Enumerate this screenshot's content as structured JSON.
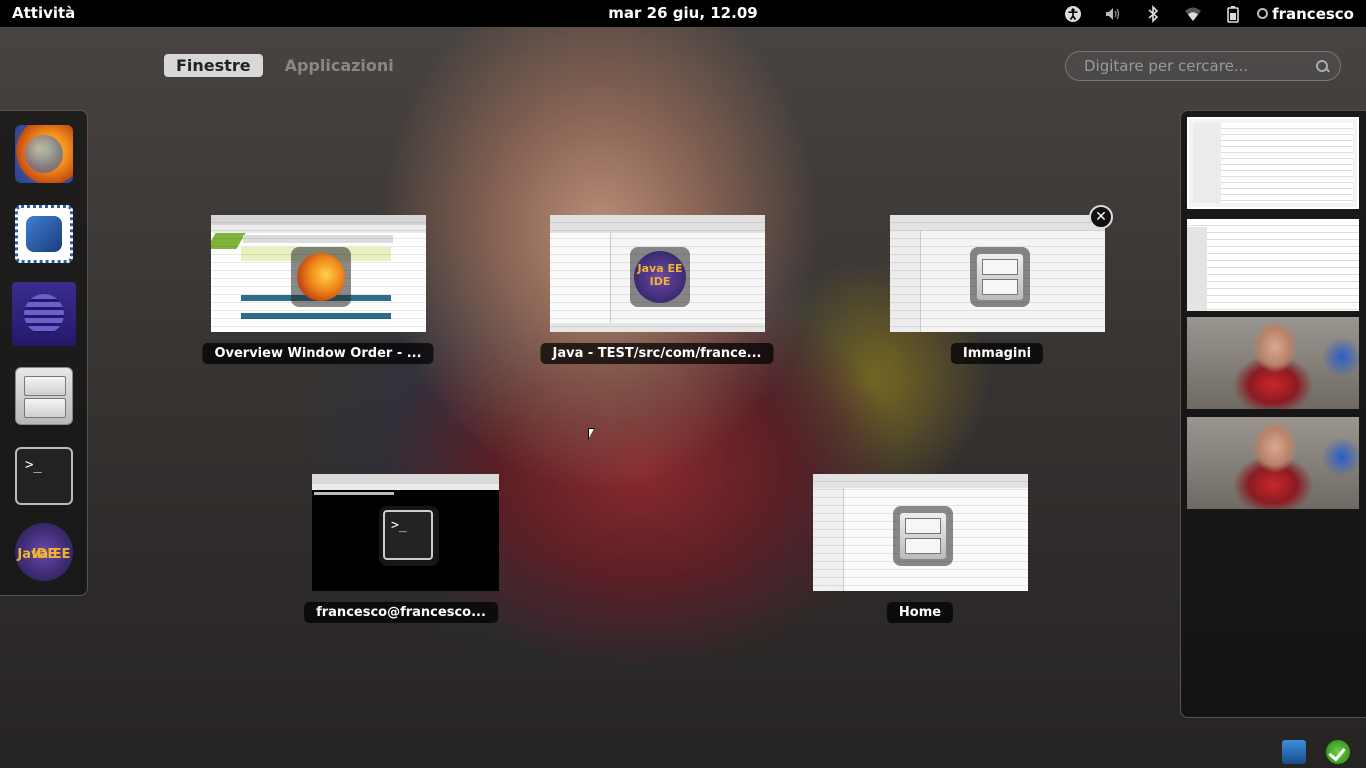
{
  "topbar": {
    "activities_label": "Attività",
    "clock": "mar 26 giu, 12.09",
    "user": "francesco",
    "tray_icons": [
      "accessibility-icon",
      "volume-icon",
      "bluetooth-icon",
      "wifi-icon",
      "battery-icon"
    ]
  },
  "tabs": {
    "windows": "Finestre",
    "applications": "Applicazioni"
  },
  "search": {
    "placeholder": "Digitare per cercare..."
  },
  "dash": {
    "apps": [
      "firefox",
      "mail",
      "eclipse",
      "files",
      "terminal",
      "java-ee-ide"
    ],
    "terminal_glyph": ">_",
    "javaee_text_1": "Java EE",
    "javaee_text_2": "IDE"
  },
  "windows": [
    {
      "title": "Overview Window Order - ...",
      "app": "firefox"
    },
    {
      "title": "Java - TEST/src/com/france...",
      "app": "java-ee-ide"
    },
    {
      "title": "Immagini",
      "app": "files"
    },
    {
      "title": "francesco@francesco...",
      "app": "terminal"
    },
    {
      "title": "Home",
      "app": "files"
    }
  ],
  "workspaces": {
    "count": 4,
    "active": 1
  },
  "colors": {
    "topbar_bg": "#000000",
    "active_tab_bg": "#d8d8d8",
    "panel_bg": "#141414"
  }
}
